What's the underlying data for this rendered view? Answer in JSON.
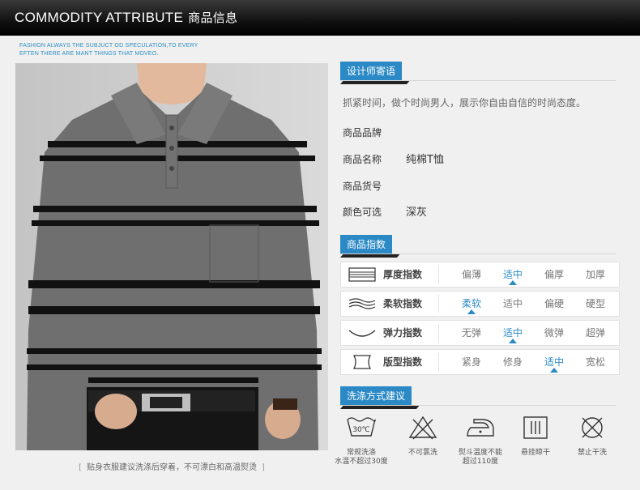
{
  "header": {
    "title_en": "COMMODITY ATTRIBUTE",
    "title_cn": "商品信息"
  },
  "tagline": {
    "line1": "FASHION ALWAYS THE  SUBJUCT OD SPECULATION,TO EVERY",
    "line2": "EFTEN THERE ARE MANT THINGS THAT MOVEO."
  },
  "caption": {
    "open": "[",
    "text": "贴身衣服建议洗涤后穿着，不可漂白和高温熨烫",
    "close": "]"
  },
  "designer": {
    "tag": "设计师寄语",
    "text": "抓紧时间，做个时尚男人，展示你自由自信的时尚态度。"
  },
  "info": [
    {
      "key": "商品品牌",
      "value": ""
    },
    {
      "key": "商品名称",
      "value": "纯棉T恤"
    },
    {
      "key": "商品货号",
      "value": ""
    },
    {
      "key": "颜色可选",
      "value": "深灰"
    }
  ],
  "index": {
    "tag": "商品指数",
    "accent": "#2b89c5",
    "rows": [
      {
        "name": "厚度指数",
        "icon": "layers-icon",
        "options": [
          "偏薄",
          "适中",
          "偏厚",
          "加厚"
        ],
        "selected": 1
      },
      {
        "name": "柔软指数",
        "icon": "wave-icon",
        "options": [
          "柔软",
          "适中",
          "偏硬",
          "硬型"
        ],
        "selected": 0
      },
      {
        "name": "弹力指数",
        "icon": "arc-icon",
        "options": [
          "无弹",
          "适中",
          "微弹",
          "超弹"
        ],
        "selected": 1
      },
      {
        "name": "版型指数",
        "icon": "body-shape-icon",
        "options": [
          "紧身",
          "修身",
          "适中",
          "宽松"
        ],
        "selected": 2
      }
    ]
  },
  "wash": {
    "tag": "洗涤方式建议",
    "temp": "30℃",
    "items": [
      {
        "icon": "washtub-30-icon",
        "line1": "常规洗涤",
        "line2": "水温不超过30度"
      },
      {
        "icon": "no-bleach-icon",
        "line1": "不可氯洗",
        "line2": ""
      },
      {
        "icon": "iron-icon",
        "line1": "熨斗温度不能",
        "line2": "超过110度"
      },
      {
        "icon": "hang-dry-icon",
        "line1": "悬挂晾干",
        "line2": ""
      },
      {
        "icon": "no-tumble-dry-icon",
        "line1": "禁止干洗",
        "line2": ""
      }
    ]
  }
}
